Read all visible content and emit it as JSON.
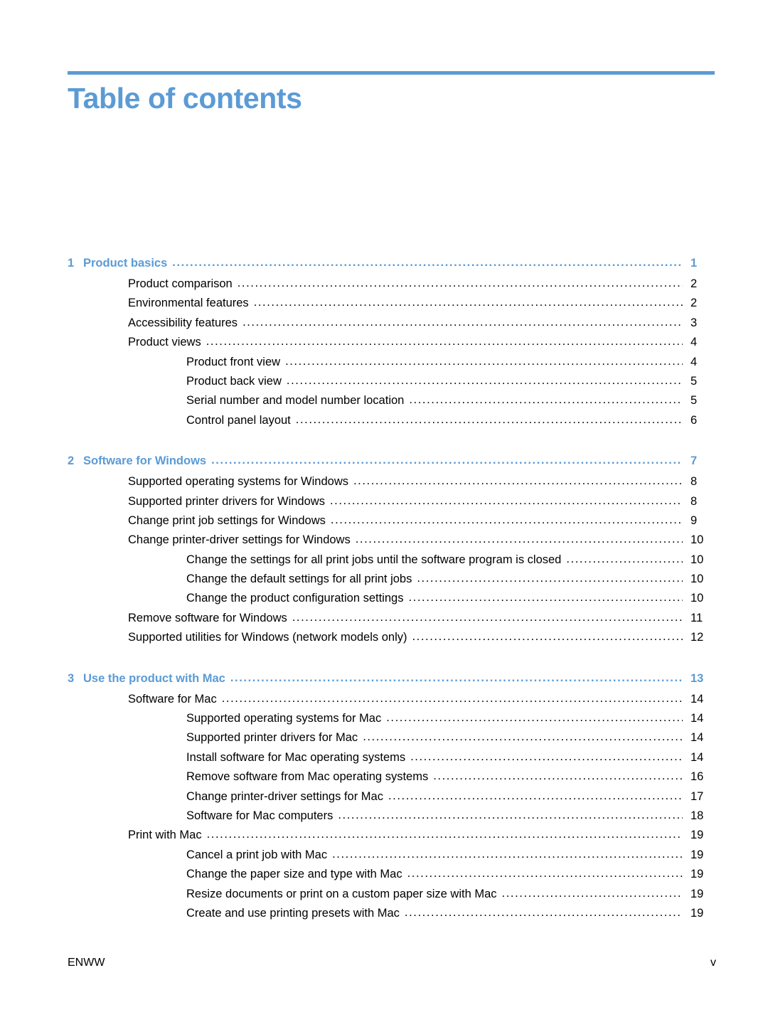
{
  "document": {
    "title": "Table of contents",
    "accent_color": "#5B9BD5",
    "text_color": "#000000",
    "background_color": "#ffffff"
  },
  "footer": {
    "left": "ENWW",
    "right": "v"
  },
  "toc": {
    "groups": [
      {
        "chapter": {
          "number": "1",
          "title": "Product basics",
          "page": "1"
        },
        "entries": [
          {
            "level": 1,
            "text": "Product comparison",
            "page": "2"
          },
          {
            "level": 1,
            "text": "Environmental features",
            "page": "2"
          },
          {
            "level": 1,
            "text": "Accessibility features",
            "page": "3"
          },
          {
            "level": 1,
            "text": "Product views",
            "page": "4"
          },
          {
            "level": 2,
            "text": "Product front view",
            "page": "4"
          },
          {
            "level": 2,
            "text": "Product back view",
            "page": "5"
          },
          {
            "level": 2,
            "text": "Serial number and model number location",
            "page": "5"
          },
          {
            "level": 2,
            "text": "Control panel layout",
            "page": "6"
          }
        ]
      },
      {
        "chapter": {
          "number": "2",
          "title": "Software for Windows",
          "page": "7"
        },
        "entries": [
          {
            "level": 1,
            "text": "Supported operating systems for Windows",
            "page": "8"
          },
          {
            "level": 1,
            "text": "Supported printer drivers for Windows",
            "page": "8"
          },
          {
            "level": 1,
            "text": "Change print job settings for Windows",
            "page": "9"
          },
          {
            "level": 1,
            "text": "Change printer-driver settings for Windows",
            "page": "10"
          },
          {
            "level": 2,
            "text": "Change the settings for all print jobs until the software program is closed",
            "page": "10"
          },
          {
            "level": 2,
            "text": "Change the default settings for all print jobs",
            "page": "10"
          },
          {
            "level": 2,
            "text": "Change the product configuration settings",
            "page": "10"
          },
          {
            "level": 1,
            "text": "Remove software for Windows",
            "page": "11"
          },
          {
            "level": 1,
            "text": "Supported utilities for Windows (network models only)",
            "page": "12"
          }
        ]
      },
      {
        "chapter": {
          "number": "3",
          "title": "Use the product with Mac",
          "page": "13"
        },
        "entries": [
          {
            "level": 1,
            "text": "Software for Mac",
            "page": "14"
          },
          {
            "level": 2,
            "text": "Supported operating systems for Mac",
            "page": "14"
          },
          {
            "level": 2,
            "text": "Supported printer drivers for Mac",
            "page": "14"
          },
          {
            "level": 2,
            "text": "Install software for Mac operating systems",
            "page": "14"
          },
          {
            "level": 2,
            "text": "Remove software from Mac operating systems",
            "page": "16"
          },
          {
            "level": 2,
            "text": "Change printer-driver settings for Mac",
            "page": "17"
          },
          {
            "level": 2,
            "text": "Software for Mac computers",
            "page": "18"
          },
          {
            "level": 1,
            "text": "Print with Mac",
            "page": "19"
          },
          {
            "level": 2,
            "text": "Cancel a print job with Mac",
            "page": "19"
          },
          {
            "level": 2,
            "text": "Change the paper size and type with Mac",
            "page": "19"
          },
          {
            "level": 2,
            "text": "Resize documents or print on a custom paper size with Mac",
            "page": "19"
          },
          {
            "level": 2,
            "text": "Create and use printing presets with Mac",
            "page": "19"
          }
        ]
      }
    ]
  }
}
